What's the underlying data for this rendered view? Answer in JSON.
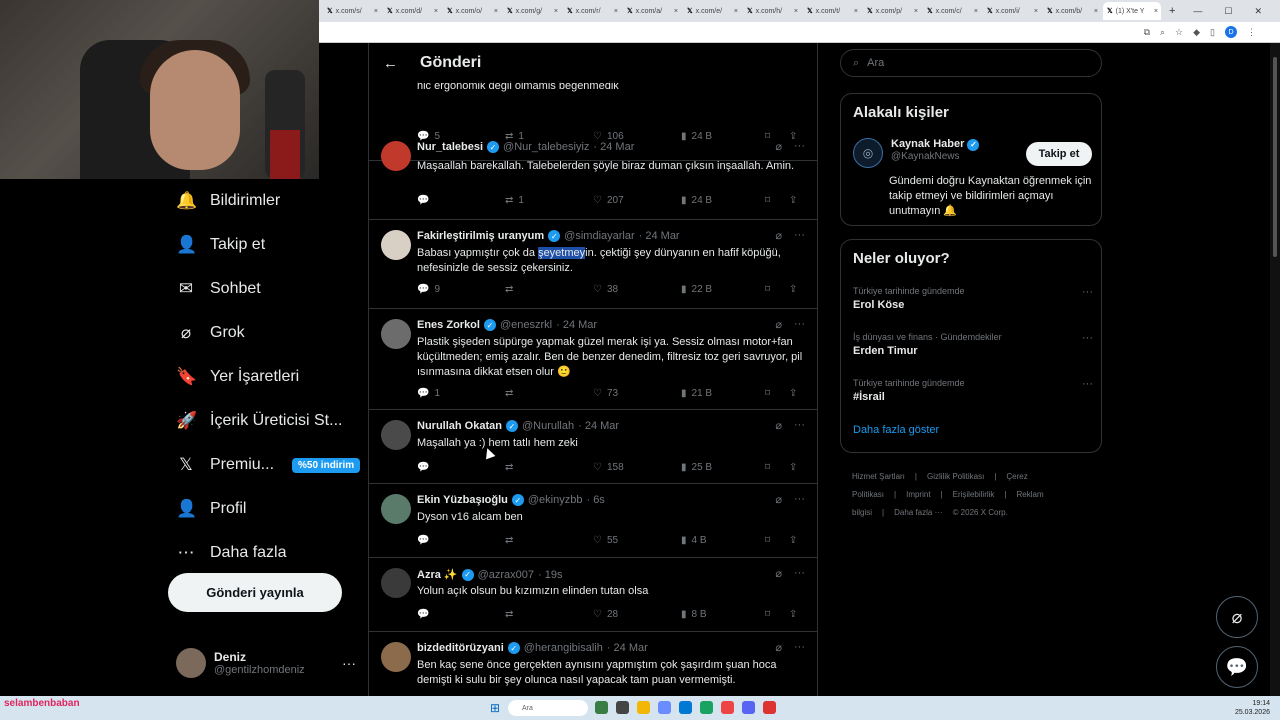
{
  "browser": {
    "tabs": [
      {
        "label": "x.com/s/"
      },
      {
        "label": "x.com/d/"
      },
      {
        "label": "x.com/o/"
      },
      {
        "label": "x.com/g/"
      },
      {
        "label": "x.com/r/"
      },
      {
        "label": "x.com/a/"
      },
      {
        "label": "x.com/e/"
      },
      {
        "label": "x.com/h/"
      },
      {
        "label": "x.com/t/"
      },
      {
        "label": "x.com/p/"
      },
      {
        "label": "x.com/c/"
      },
      {
        "label": "x.com/i/"
      },
      {
        "label": "x.com/b/"
      },
      {
        "label": "(1) X'te Y"
      }
    ],
    "new_tab": "+",
    "profile_initial": "D"
  },
  "nav": {
    "items": [
      {
        "label": "Bildirimler",
        "icon": "bell-icon",
        "glyph": "🔔"
      },
      {
        "label": "Takip et",
        "icon": "person-add-icon",
        "glyph": "👤"
      },
      {
        "label": "Sohbet",
        "icon": "mail-icon",
        "glyph": "✉"
      },
      {
        "label": "Grok",
        "icon": "grok-icon",
        "glyph": "⌀"
      },
      {
        "label": "Yer İşaretleri",
        "icon": "bookmark-icon",
        "glyph": "🔖"
      },
      {
        "label": "İçerik Üreticisi St...",
        "icon": "rocket-icon",
        "glyph": "🚀"
      },
      {
        "label": "Premiu...",
        "icon": "x-logo-icon",
        "glyph": "𝕏",
        "badge": "%50 indirim"
      },
      {
        "label": "Profil",
        "icon": "profile-icon",
        "glyph": "👤"
      },
      {
        "label": "Daha fazla",
        "icon": "more-circle-icon",
        "glyph": "⋯"
      }
    ],
    "post_button": "Gönderi yayınla",
    "account": {
      "name": "Deniz",
      "handle": "@gentilzhomdeniz",
      "more": "···"
    }
  },
  "main": {
    "title": "Gönderi",
    "back": "←",
    "tweets": [
      {
        "name": "",
        "handle": "",
        "date": "",
        "text": "hic ergonomik degil olmamis begenmedik",
        "replies": "5",
        "retweets": "1",
        "likes": "106",
        "views": "24 B"
      },
      {
        "name": "Nur_talebesi",
        "handle": "@Nur_talebesiyiz",
        "date": "· 24 Mar",
        "text": "Maşaallah barekallah. Talebelerden şöyle biraz duman çıksın inşaallah. Amin.",
        "replies": "",
        "retweets": "1",
        "likes": "207",
        "views": "24 B"
      },
      {
        "name": "Fakirleştirilmiş uranyum",
        "handle": "@simdiayarlar",
        "date": "· 24 Mar",
        "text_before": "Babası yapmıştır çok da ",
        "text_highlight": "şeyetmey",
        "text_after": "in. çektiği şey dünyanın en hafif köpüğü, nefesinizle de sessiz çekersiniz.",
        "replies": "9",
        "retweets": "",
        "likes": "38",
        "views": "22 B"
      },
      {
        "name": "Enes Zorkol",
        "handle": "@eneszrkl",
        "date": "· 24 Mar",
        "text": "Plastik şişeden süpürge yapmak güzel merak işi ya. Sessiz olması motor+fan küçültmeden; emiş azalır. Ben de benzer denedim, filtresiz toz geri savruyor, pil ısınmasına dikkat etsen olur 🙂",
        "replies": "1",
        "retweets": "",
        "likes": "73",
        "views": "21 B"
      },
      {
        "name": "Nurullah Okatan",
        "handle": "@Nurullah",
        "date": "· 24 Mar",
        "text": "Maşallah ya :) hem tatlı hem zeki",
        "replies": "",
        "retweets": "",
        "likes": "158",
        "views": "25 B"
      },
      {
        "name": "Ekin Yüzbaşıoğlu",
        "handle": "@ekinyzbb",
        "date": "· 6s",
        "text": "Dyson v16 alcam ben",
        "replies": "",
        "retweets": "",
        "likes": "55",
        "views": "4 B"
      },
      {
        "name": "Azra ✨",
        "handle": "@azrax007",
        "date": "· 19s",
        "text": "Yolun açık olsun bu kızımızın elinden tutan olsa",
        "replies": "",
        "retweets": "",
        "likes": "28",
        "views": "8 B"
      },
      {
        "name": "bizdeditörüzyani",
        "handle": "@herangibisalih",
        "date": "· 24 Mar",
        "text": "Ben kaç sene önce gerçekten aynısını yapmıştım çok şaşırdım şuan hoca demişti ki sulu bir şey olunca nasıl yapacak tam puan vermemişti.",
        "replies": "",
        "retweets": "",
        "likes": "",
        "views": ""
      }
    ]
  },
  "right": {
    "search_placeholder": "Ara",
    "related": {
      "title": "Alakalı kişiler",
      "name": "Kaynak Haber",
      "handle": "@KaynakNews",
      "bio": "Gündemi doğru Kaynaktan öğrenmek için takip etmeyi ve bildirimleri açmayı unutmayın 🔔",
      "follow": "Takip et"
    },
    "trends": {
      "title": "Neler oluyor?",
      "items": [
        {
          "context": "Türkiye tarihinde gündemde",
          "name": "Erol Köse"
        },
        {
          "context": "İş dünyası ve finans · Gündemdekiler",
          "name": "Erden Timur"
        },
        {
          "context": "Türkiye tarihinde gündemde",
          "name": "#İsrail"
        }
      ],
      "show_more": "Daha fazla göster"
    },
    "footer": [
      "Hizmet Şartları",
      "|",
      "Gizlilik Politikası",
      "|",
      "Çerez Politikası",
      "|",
      "Imprint",
      "|",
      "Erişilebilirlik",
      "|",
      "Reklam bilgisi",
      "|",
      "Daha fazla ···",
      "© 2026 X Corp."
    ]
  },
  "taskbar": {
    "search": "Ara",
    "time": "19:14",
    "date": "25.03.2026",
    "overlay_user": "selambenbaban"
  }
}
